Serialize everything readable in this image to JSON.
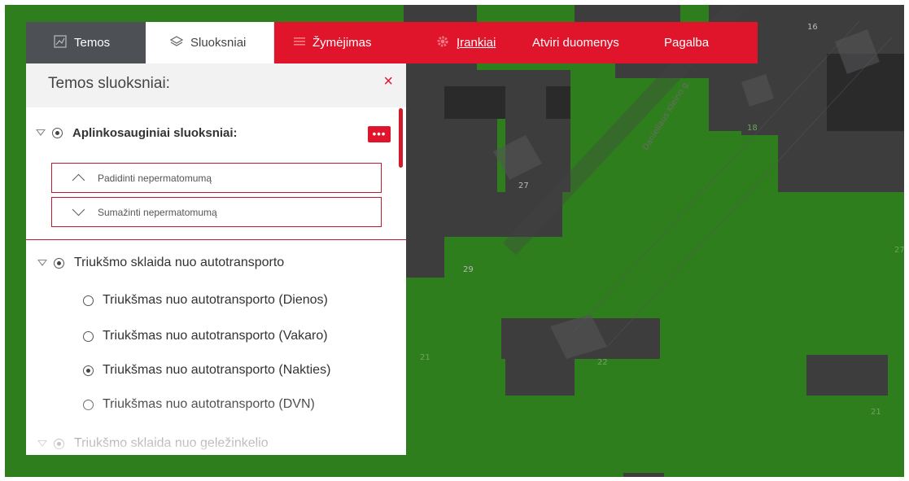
{
  "tabs": {
    "temos": "Temos",
    "sluoksniai": "Sluoksniai",
    "zymejimas": "Žymėjimas",
    "irankiai": "Įrankiai",
    "atviri_duomenys": "Atviri duomenys",
    "pagalba": "Pagalba"
  },
  "panel": {
    "title": "Temos sluoksniai:",
    "close_icon": "×",
    "groups": [
      {
        "title": "Aplinkosauginiai sluoksniai:",
        "more_label": "•••",
        "opacity_increase": "Padidinti nepermatomumą",
        "opacity_decrease": "Sumažinti nepermatomumą"
      },
      {
        "title": "Triukšmo sklaida nuo autotransporto",
        "layers": [
          {
            "label": "Triukšmas nuo autotransporto (Dienos)",
            "selected": false
          },
          {
            "label": "Triukšmas nuo autotransporto (Vakaro)",
            "selected": false
          },
          {
            "label": "Triukšmas nuo autotransporto (Nakties)",
            "selected": true
          },
          {
            "label": "Triukšmas nuo autotransporto (DVN)",
            "selected": false
          }
        ]
      },
      {
        "title": "Triukšmo sklaida nuo geležinkelio"
      }
    ]
  },
  "map": {
    "labels": [
      "16",
      "18",
      "27",
      "29",
      "22",
      "21",
      "21",
      "27"
    ],
    "street": "Danieliaus Kleino g."
  },
  "colors": {
    "accent": "#e0142a",
    "map_green": "#2f7e1d",
    "map_dark": "#3b3b3b"
  }
}
